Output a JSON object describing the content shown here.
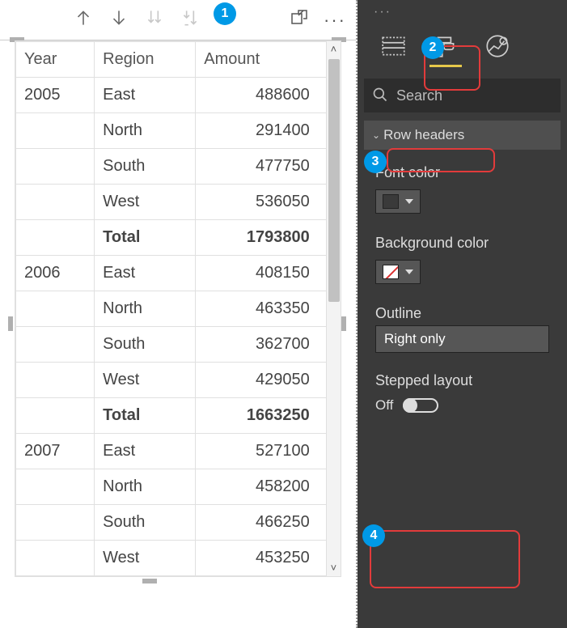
{
  "callouts": {
    "b1": "1",
    "b2": "2",
    "b3": "3",
    "b4": "4"
  },
  "toolbar": {
    "drill_up": "drill-up",
    "drill_down": "drill-down",
    "expand_all": "expand-all-down",
    "expand_next": "expand-next-level",
    "focus_mode": "focus-mode",
    "more": "···"
  },
  "table": {
    "headers": {
      "year": "Year",
      "region": "Region",
      "amount": "Amount"
    },
    "rows": [
      {
        "year": "2005",
        "region": "East",
        "amount": "488600"
      },
      {
        "year": "",
        "region": "North",
        "amount": "291400"
      },
      {
        "year": "",
        "region": "South",
        "amount": "477750"
      },
      {
        "year": "",
        "region": "West",
        "amount": "536050"
      },
      {
        "year": "",
        "region": "Total",
        "amount": "1793800",
        "total": true
      },
      {
        "year": "2006",
        "region": "East",
        "amount": "408150"
      },
      {
        "year": "",
        "region": "North",
        "amount": "463350"
      },
      {
        "year": "",
        "region": "South",
        "amount": "362700"
      },
      {
        "year": "",
        "region": "West",
        "amount": "429050"
      },
      {
        "year": "",
        "region": "Total",
        "amount": "1663250",
        "total": true
      },
      {
        "year": "2007",
        "region": "East",
        "amount": "527100"
      },
      {
        "year": "",
        "region": "North",
        "amount": "458200"
      },
      {
        "year": "",
        "region": "South",
        "amount": "466250"
      },
      {
        "year": "",
        "region": "West",
        "amount": "453250"
      }
    ]
  },
  "format_pane": {
    "search_placeholder": "Search",
    "section_title": "Row headers",
    "font_color_label": "Font color",
    "background_color_label": "Background color",
    "outline_label": "Outline",
    "outline_value": "Right only",
    "stepped_label": "Stepped layout",
    "stepped_value": "Off"
  }
}
